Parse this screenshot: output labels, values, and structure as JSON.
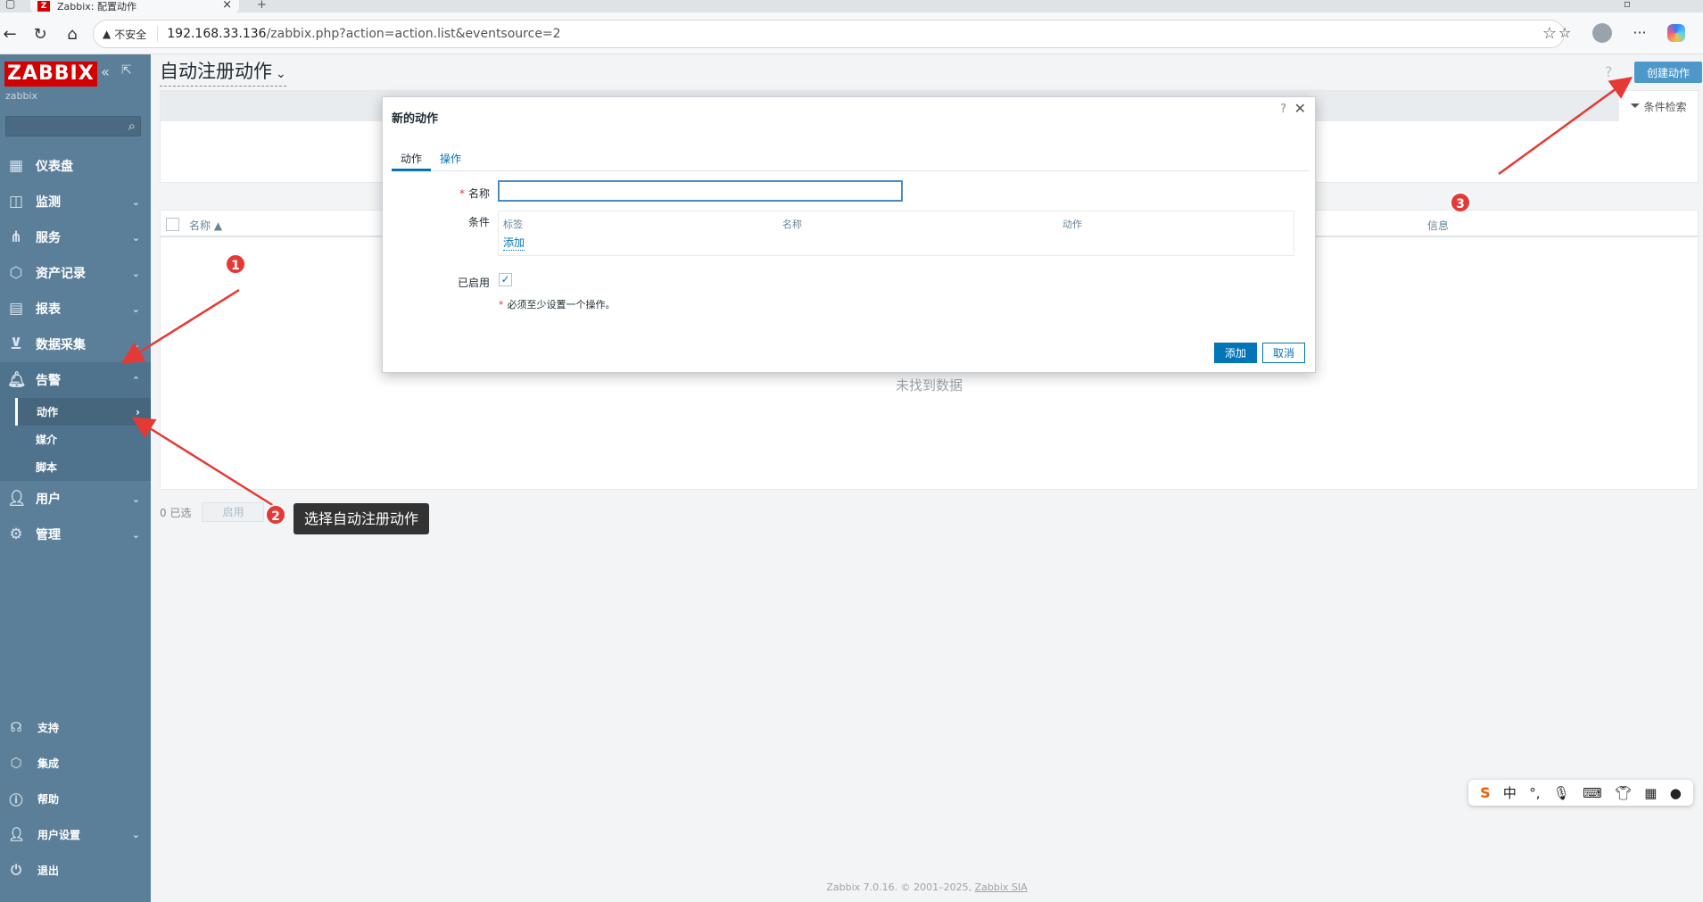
{
  "browser": {
    "tab_title": "Zabbix: 配置动作",
    "tab_icon": "Z",
    "insecure_label": "不安全",
    "url_host": "192.168.33.136",
    "url_path": "/zabbix.php?action=action.list&eventsource=2"
  },
  "sidebar": {
    "logo": "ZABBIX",
    "server_name": "zabbix",
    "search_placeholder": "",
    "items": [
      {
        "label": "仪表盘",
        "icon": "dashboard-icon"
      },
      {
        "label": "监测",
        "icon": "monitoring-icon"
      },
      {
        "label": "服务",
        "icon": "services-icon"
      },
      {
        "label": "资产记录",
        "icon": "inventory-icon"
      },
      {
        "label": "报表",
        "icon": "reports-icon"
      },
      {
        "label": "数据采集",
        "icon": "data-collection-icon"
      },
      {
        "label": "告警",
        "icon": "bell-icon"
      }
    ],
    "alerts_submenu": [
      {
        "label": "动作"
      },
      {
        "label": "媒介"
      },
      {
        "label": "脚本"
      }
    ],
    "items_after": [
      {
        "label": "用户",
        "icon": "users-icon"
      },
      {
        "label": "管理",
        "icon": "gear-icon"
      }
    ],
    "bottom": [
      {
        "label": "支持",
        "icon": "headset-icon"
      },
      {
        "label": "集成",
        "icon": "integrations-icon"
      },
      {
        "label": "帮助",
        "icon": "help-icon"
      },
      {
        "label": "用户设置",
        "icon": "user-settings-icon"
      },
      {
        "label": "退出",
        "icon": "power-icon"
      }
    ]
  },
  "main": {
    "title": "自动注册动作",
    "create_button": "创建动作",
    "filter_tab": "条件检索",
    "table_headers": {
      "name": "名称 ▲",
      "info": "信息"
    },
    "no_data": "未找到数据",
    "selected_count": "0 已选",
    "enable_button": "启用",
    "footer_text": "Zabbix 7.0.16. © 2001–2025,",
    "footer_link": "Zabbix SIA"
  },
  "dialog": {
    "title": "新的动作",
    "tabs": [
      "动作",
      "操作"
    ],
    "name_label": "名称",
    "name_value": "",
    "conditions_label": "条件",
    "conditions_headers": [
      "标签",
      "名称",
      "动作"
    ],
    "add_condition_link": "添加",
    "enabled_label": "已启用",
    "enabled_checked": true,
    "note": "必须至少设置一个操作。",
    "add_button": "添加",
    "cancel_button": "取消"
  },
  "annotations": {
    "badge1": "1",
    "badge2": "2",
    "badge3": "3",
    "tooltip": "选择自动注册动作"
  },
  "ime_toolbar": {
    "logo": "S",
    "mode": "中"
  },
  "colors": {
    "sidebar": "#5b7f99",
    "accent": "#0275b8",
    "logo_red": "#d40000",
    "annotation_red": "#e53935"
  }
}
